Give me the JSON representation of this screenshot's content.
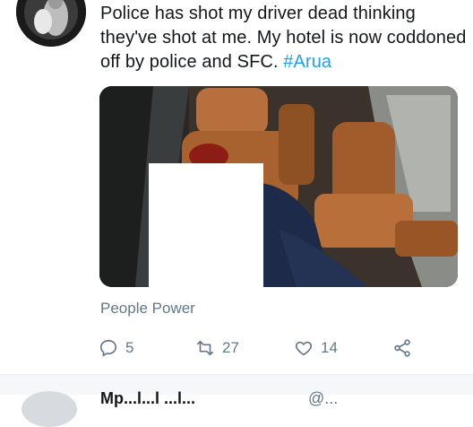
{
  "tweet": {
    "text": "Police has shot my driver dead thinking they've shot at me. My hotel is now coddoned off by police and SFC.",
    "hashtag": "#Arua",
    "source": "People Power"
  },
  "media": {
    "description_icon": "photo-icon"
  },
  "actions": {
    "replies": "5",
    "retweets": "27",
    "likes": "14"
  },
  "next_tweet": {
    "name": "Mp...l...l ...l...",
    "handle": "@..."
  },
  "colors": {
    "accent": "#1da1f2",
    "secondary_text": "#657786"
  }
}
